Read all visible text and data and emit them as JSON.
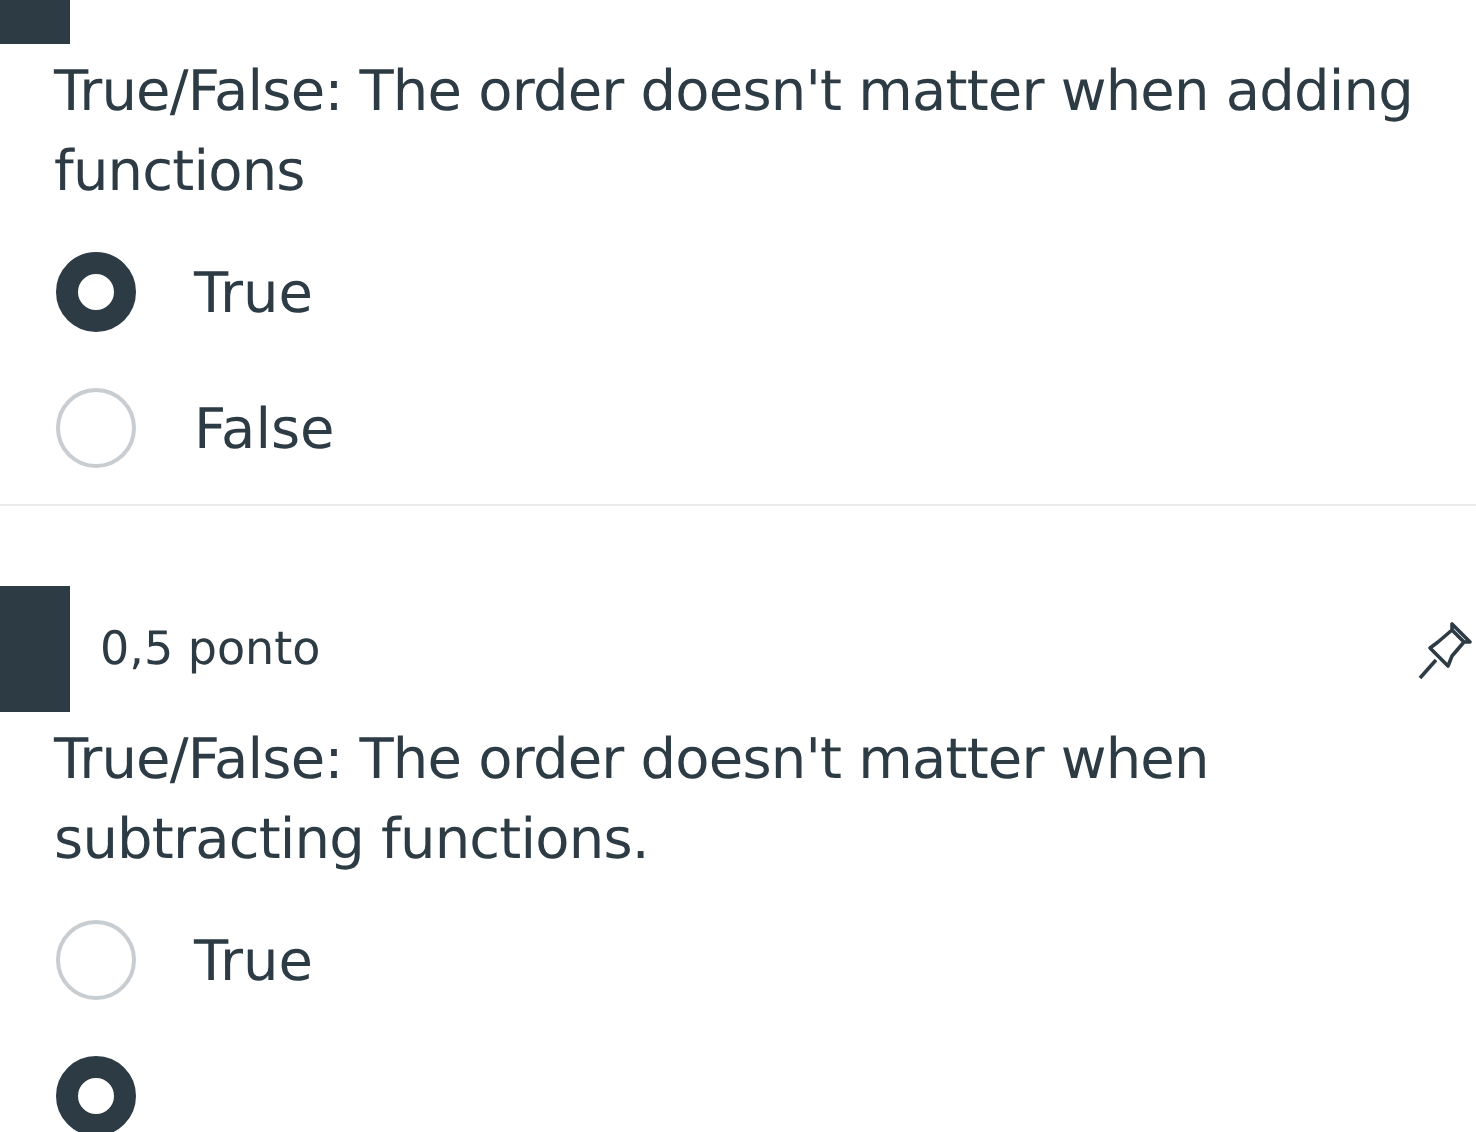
{
  "questions": [
    {
      "text": "True/False: The order doesn't matter when adding functions",
      "options": [
        {
          "label": "True",
          "selected": true
        },
        {
          "label": "False",
          "selected": false
        }
      ]
    },
    {
      "points": "0,5 ponto",
      "text": "True/False: The order doesn't matter when subtracting functions.",
      "pinned": true,
      "options": [
        {
          "label": "True",
          "selected": false
        },
        {
          "selected": true
        }
      ]
    }
  ]
}
